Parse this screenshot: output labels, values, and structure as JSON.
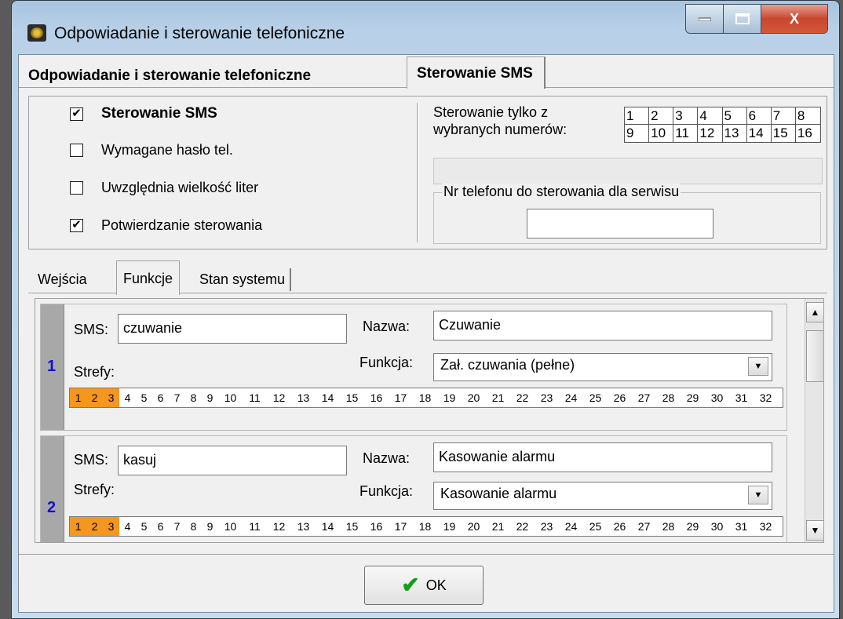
{
  "window": {
    "title": "Odpowiadanie i sterowanie telefoniczne",
    "close_glyph": "X"
  },
  "top_tabs": [
    "Odpowiadanie i sterowanie telefoniczne",
    "Sterowanie SMS"
  ],
  "options": {
    "sms_control": {
      "label": "Sterowanie SMS",
      "checked": true
    },
    "password_required": {
      "label": "Wymagane hasło tel.",
      "checked": false
    },
    "case_sensitive": {
      "label": "Uwzględnia wielkość liter",
      "checked": false
    },
    "confirm_control": {
      "label": "Potwierdzanie sterowania",
      "checked": true
    }
  },
  "numbers_label_1": "Sterowanie tylko z",
  "numbers_label_2": "wybranych numerów:",
  "numbers": [
    "1",
    "2",
    "3",
    "4",
    "5",
    "6",
    "7",
    "8",
    "9",
    "10",
    "11",
    "12",
    "13",
    "14",
    "15",
    "16"
  ],
  "service_group": {
    "title": "Nr telefonu do sterowania dla serwisu",
    "value": ""
  },
  "mid_tabs": [
    "Wejścia",
    "Funkcje",
    "Stan systemu"
  ],
  "labels": {
    "sms": "SMS:",
    "name": "Nazwa:",
    "function": "Funkcja:",
    "zones": "Strefy:"
  },
  "zone_numbers": [
    "1",
    "2",
    "3",
    "4",
    "5",
    "6",
    "7",
    "8",
    "9",
    "10",
    "11",
    "12",
    "13",
    "14",
    "15",
    "16",
    "17",
    "18",
    "19",
    "20",
    "21",
    "22",
    "23",
    "24",
    "25",
    "26",
    "27",
    "28",
    "29",
    "30",
    "31",
    "32"
  ],
  "entries": [
    {
      "index": "1",
      "sms": "czuwanie",
      "name": "Czuwanie",
      "function": "Zał. czuwania (pełne)",
      "active_zones": [
        1,
        2,
        3
      ]
    },
    {
      "index": "2",
      "sms": "kasuj",
      "name": "Kasowanie alarmu",
      "function": "Kasowanie alarmu",
      "active_zones": [
        1,
        2,
        3
      ]
    }
  ],
  "ok_button": "OK"
}
